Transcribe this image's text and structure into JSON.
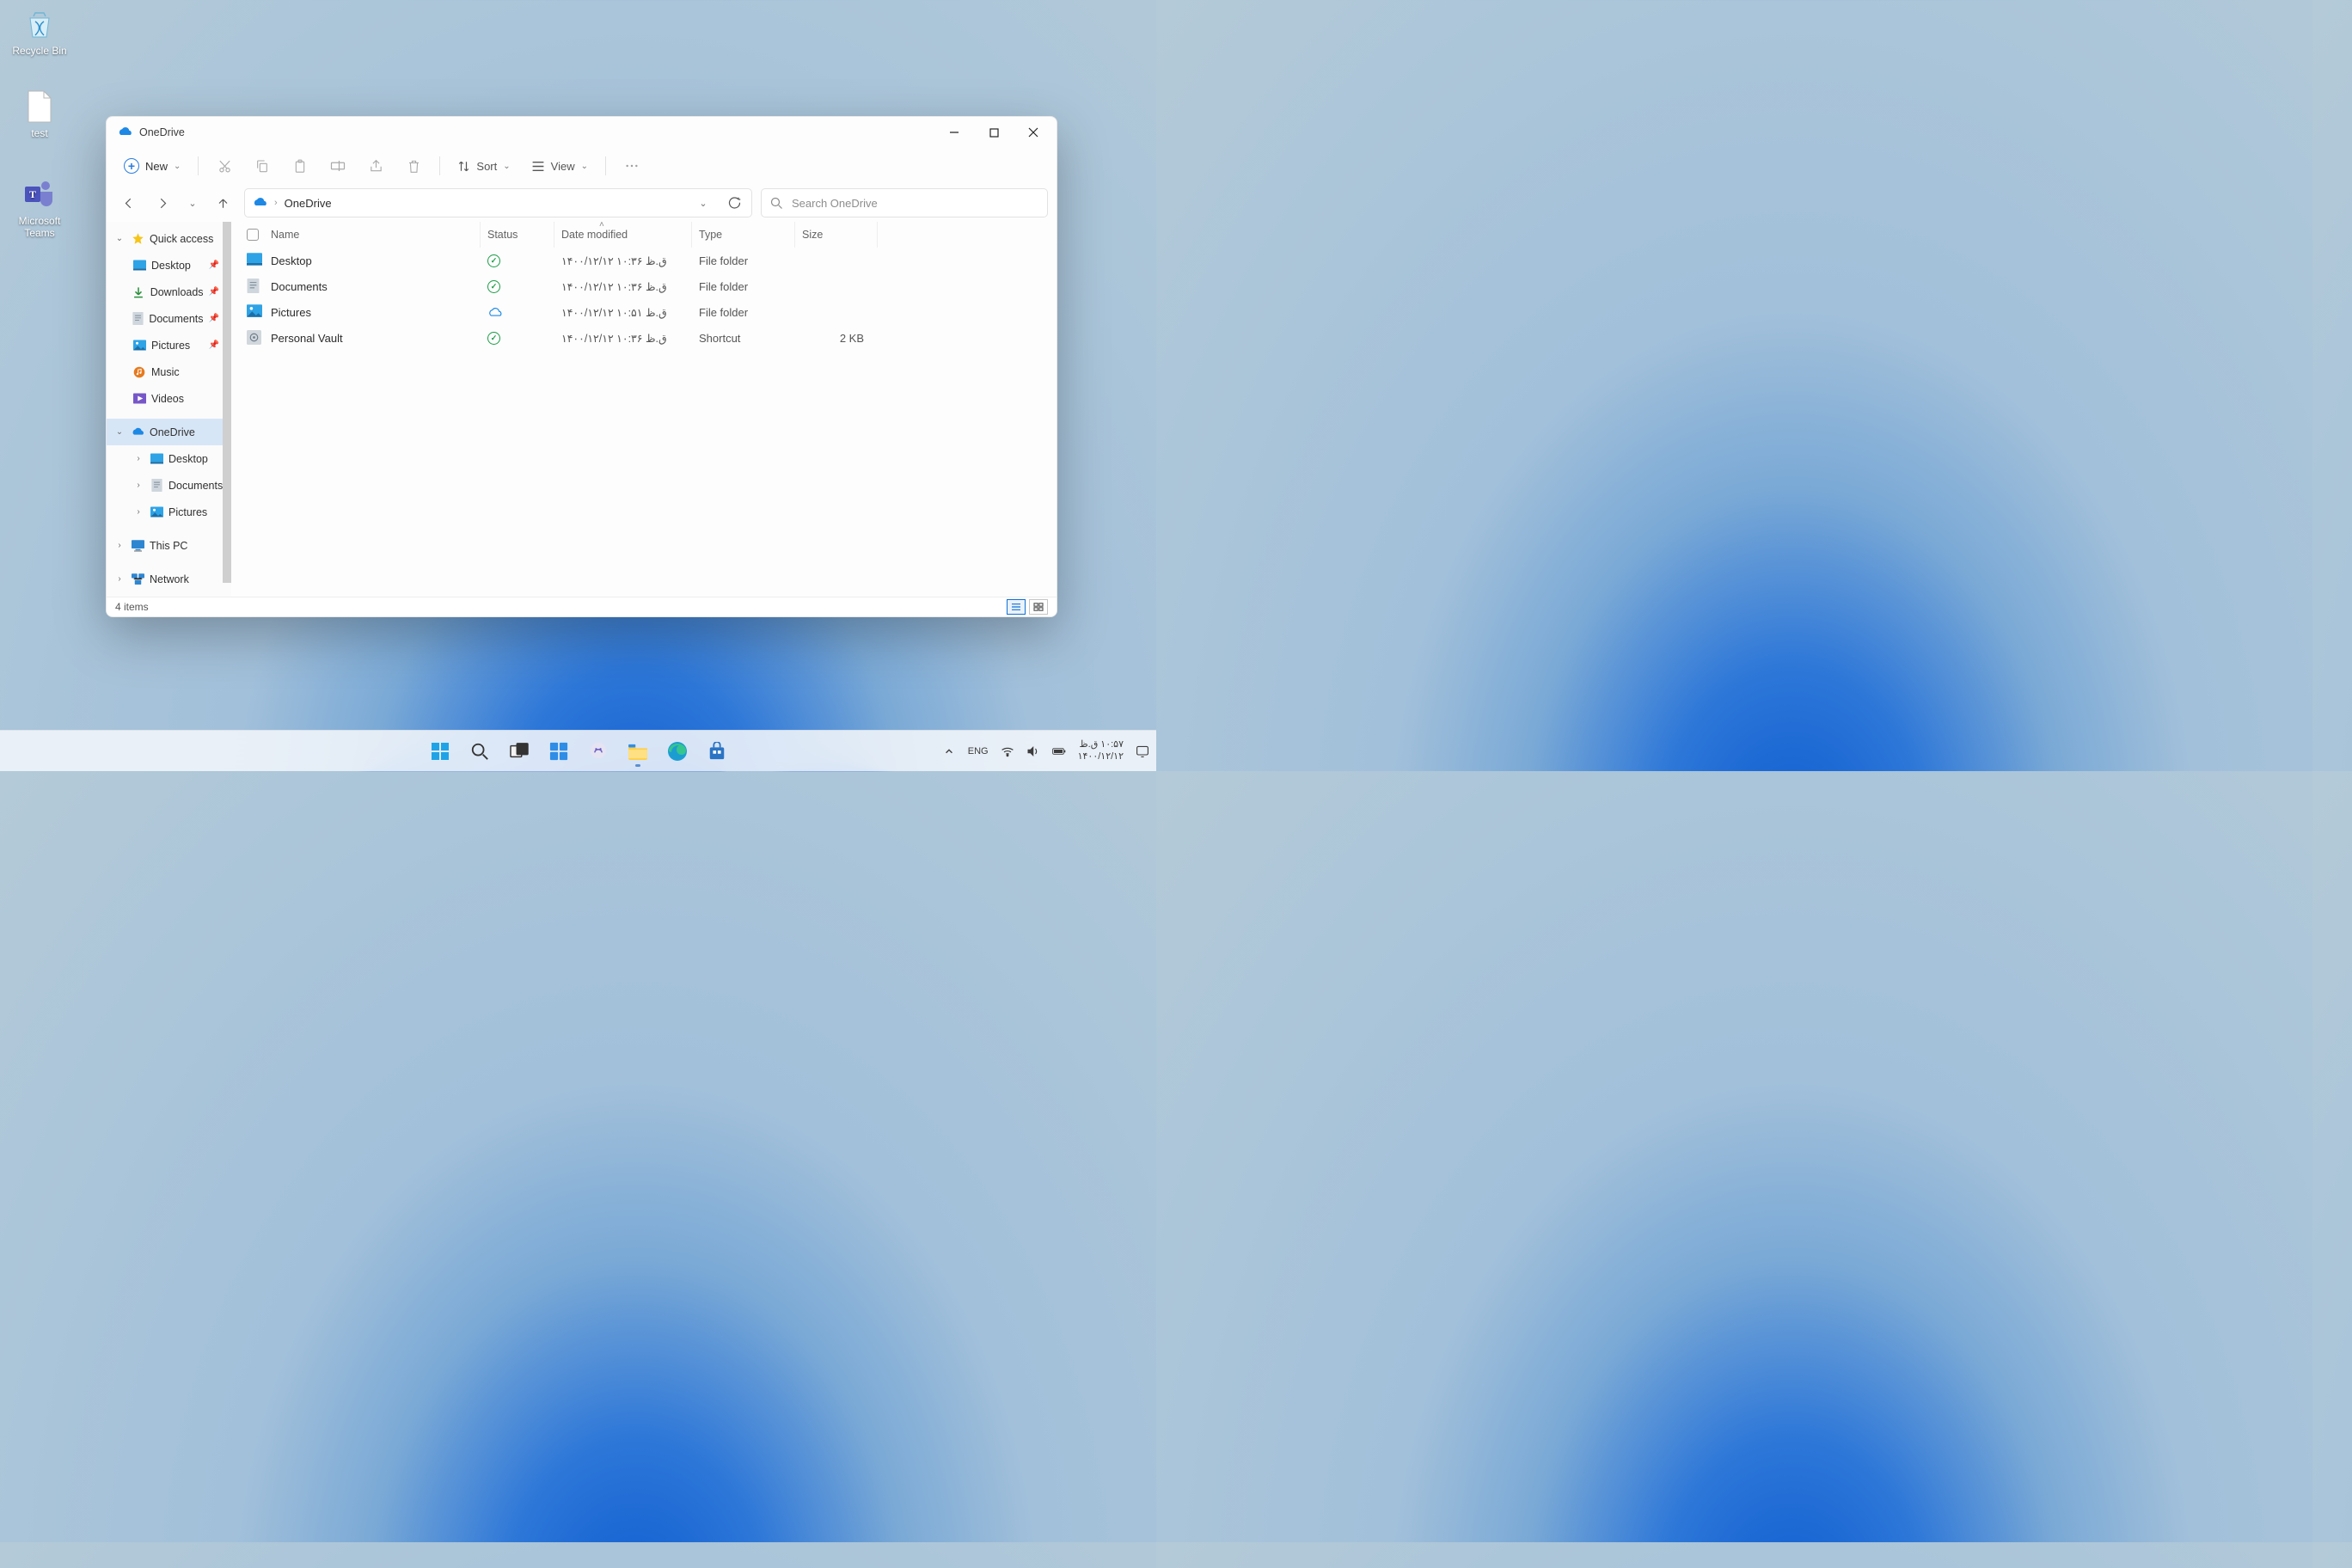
{
  "desktop": {
    "icons": [
      {
        "name": "Recycle Bin"
      },
      {
        "name": "test"
      },
      {
        "name": "Microsoft Teams"
      }
    ]
  },
  "window": {
    "title": "OneDrive",
    "toolbar": {
      "new_label": "New",
      "sort_label": "Sort",
      "view_label": "View"
    },
    "search_placeholder": "Search OneDrive",
    "breadcrumb": "OneDrive",
    "sidebar": {
      "quick_access": "Quick access",
      "quick_items": [
        {
          "label": "Desktop",
          "pinned": true
        },
        {
          "label": "Downloads",
          "pinned": true
        },
        {
          "label": "Documents",
          "pinned": true
        },
        {
          "label": "Pictures",
          "pinned": true
        },
        {
          "label": "Music",
          "pinned": false
        },
        {
          "label": "Videos",
          "pinned": false
        }
      ],
      "onedrive": "OneDrive",
      "od_items": [
        {
          "label": "Desktop"
        },
        {
          "label": "Documents"
        },
        {
          "label": "Pictures"
        }
      ],
      "this_pc": "This PC",
      "network": "Network"
    },
    "columns": {
      "name": "Name",
      "status": "Status",
      "date": "Date modified",
      "type": "Type",
      "size": "Size"
    },
    "rows": [
      {
        "name": "Desktop",
        "status": "synced",
        "date": "۱۴۰۰/۱۲/۱۲ ق.ظ ۱۰:۳۶",
        "type": "File folder",
        "size": ""
      },
      {
        "name": "Documents",
        "status": "synced",
        "date": "۱۴۰۰/۱۲/۱۲ ق.ظ ۱۰:۳۶",
        "type": "File folder",
        "size": ""
      },
      {
        "name": "Pictures",
        "status": "cloud",
        "date": "۱۴۰۰/۱۲/۱۲ ق.ظ ۱۰:۵۱",
        "type": "File folder",
        "size": ""
      },
      {
        "name": "Personal Vault",
        "status": "synced",
        "date": "۱۴۰۰/۱۲/۱۲ ق.ظ ۱۰:۳۶",
        "type": "Shortcut",
        "size": "2 KB"
      }
    ],
    "status_text": "4 items"
  },
  "tray": {
    "lang": "ENG",
    "time": "۱۰:۵۷ ق.ظ",
    "date": "۱۴۰۰/۱۲/۱۲"
  }
}
